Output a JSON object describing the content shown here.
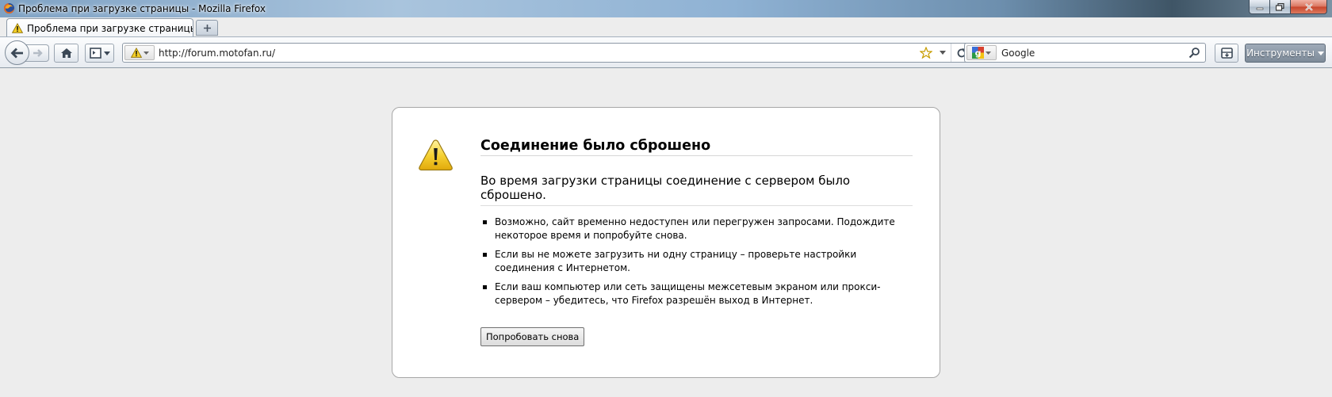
{
  "window": {
    "title": "Проблема при загрузке страницы - Mozilla Firefox"
  },
  "tabs": [
    {
      "label": "Проблема при загрузке страницы",
      "icon": "warning-icon",
      "active": true
    }
  ],
  "new_tab": {
    "icon": "plus-icon"
  },
  "toolbar": {
    "url": "http://forum.motofan.ru/",
    "search_engine_icon": "google-icon",
    "search_text": "Google",
    "tools_label": "Инструменты"
  },
  "error": {
    "title": "Соединение было сброшено",
    "description": "Во время загрузки страницы соединение с сервером было сброшено.",
    "items": [
      "Возможно, сайт временно недоступен или перегружен запросами. Подождите некоторое время и попробуйте снова.",
      "Если вы не можете загрузить ни одну страницу – проверьте настройки соединения с Интернетом.",
      "Если ваш компьютер или сеть защищены межсетевым экраном или прокси-сервером – убедитесь, что Firefox разрешён выход в Интернет."
    ],
    "retry_label": "Попробовать снова"
  },
  "colors": {
    "content_bg": "#ededed",
    "warning_yellow": "#f4cf27",
    "close_red": "#c7442a"
  }
}
